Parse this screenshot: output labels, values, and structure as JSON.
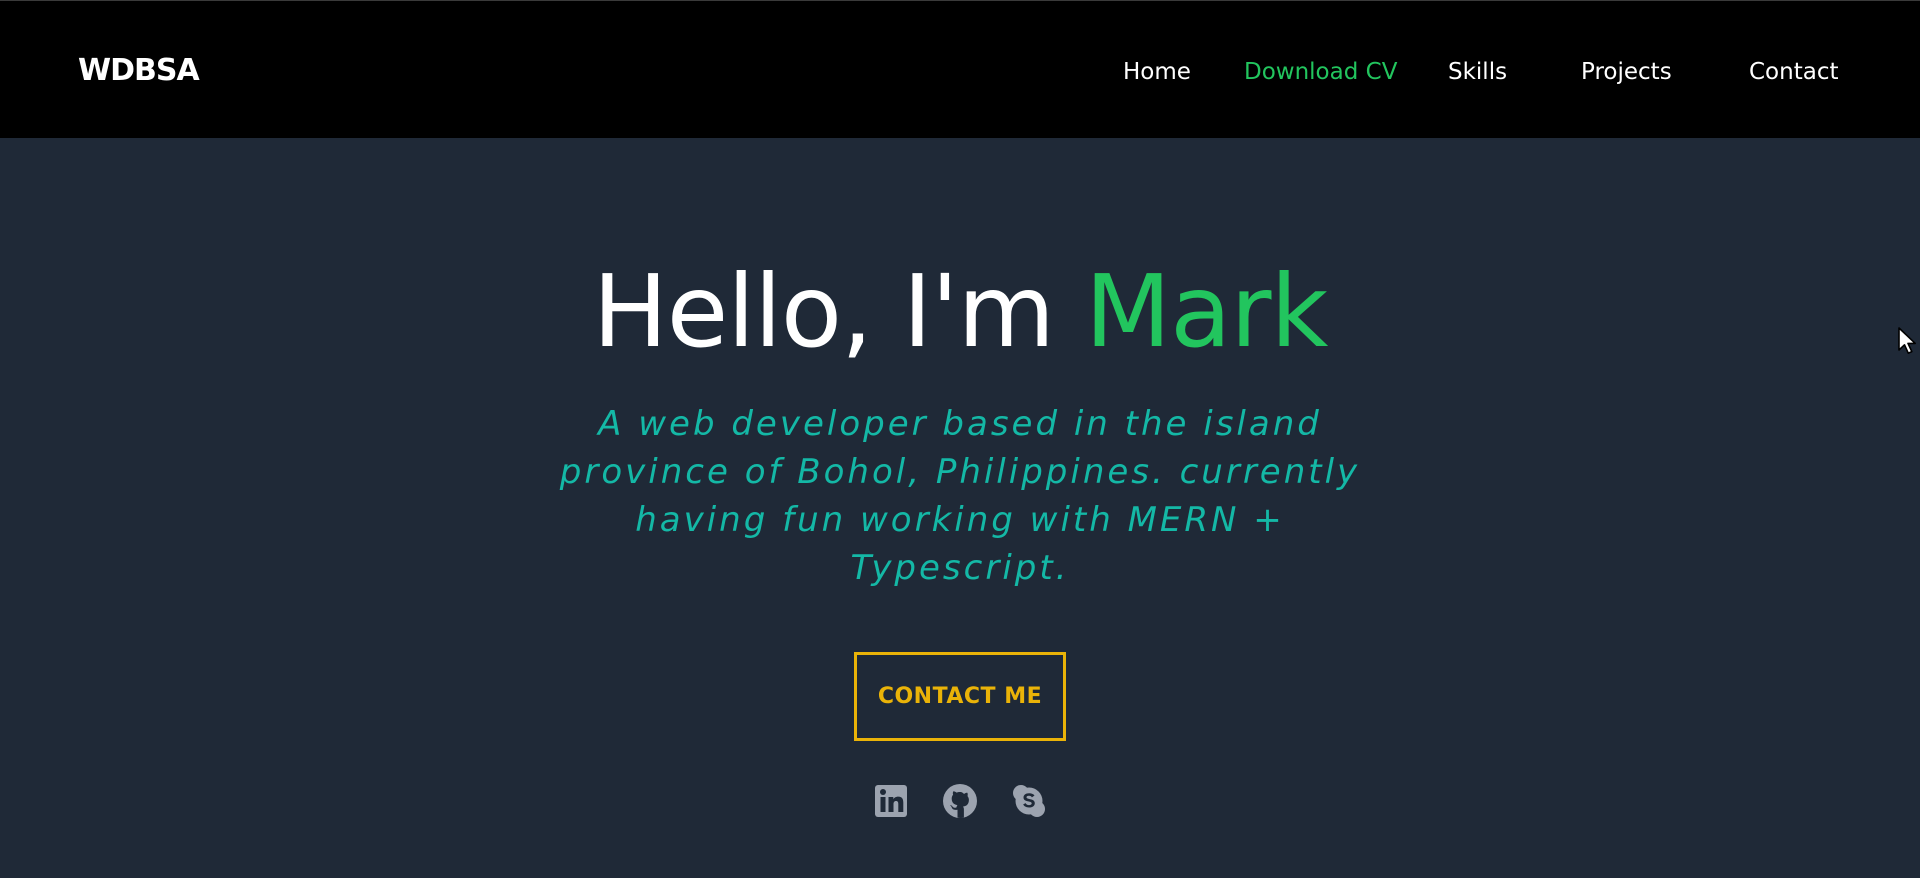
{
  "header": {
    "logo": "WDBSA",
    "nav": {
      "home": "Home",
      "download_cv": "Download CV",
      "skills": "Skills",
      "projects": "Projects",
      "contact": "Contact"
    }
  },
  "hero": {
    "greeting": "Hello, I'm",
    "name": "Mark",
    "subtitle": "A web developer based in the island province of Bohol, Philippines. currently having fun working with MERN + Typescript.",
    "cta_label": "CONTACT ME"
  },
  "social": {
    "icons": [
      "linkedin-icon",
      "github-icon",
      "skype-icon"
    ]
  },
  "colors": {
    "background": "#1f2937",
    "navbar": "#000000",
    "accent_green": "#22c55e",
    "subtitle_teal": "#14b8a6",
    "cta_yellow": "#eab308",
    "icon_gray": "#9ca3af"
  }
}
